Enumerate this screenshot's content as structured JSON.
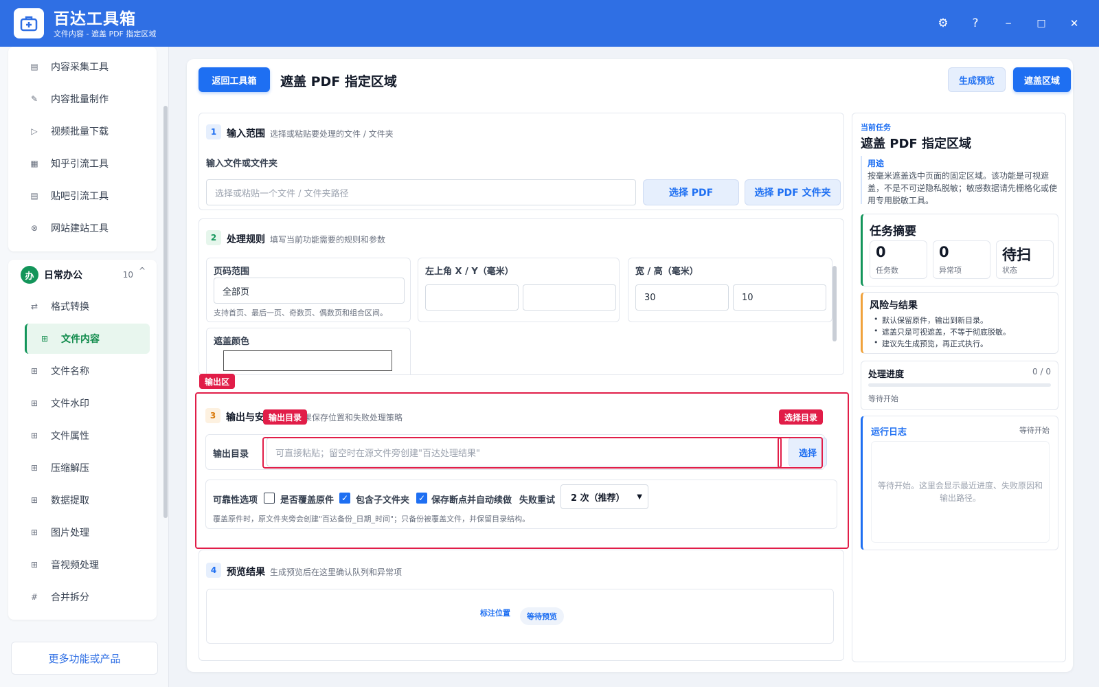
{
  "app": {
    "title": "百达工具箱",
    "subtitle": "文件内容 - 遮盖 PDF 指定区域"
  },
  "window_controls": {
    "settings": "⚙",
    "help": "?",
    "minimize": "−",
    "maximize": "□",
    "close": "✕"
  },
  "sidebar": {
    "top_items": [
      {
        "label": "内容采集工具",
        "icon": "▤"
      },
      {
        "label": "内容批量制作",
        "icon": "✎"
      },
      {
        "label": "视频批量下载",
        "icon": "▷"
      },
      {
        "label": "知乎引流工具",
        "icon": "▦"
      },
      {
        "label": "贴吧引流工具",
        "icon": "▤"
      },
      {
        "label": "网站建站工具",
        "icon": "⊗"
      }
    ],
    "group": {
      "badge": "办",
      "name": "日常办公",
      "count": "10",
      "chevron": "^"
    },
    "group_items": [
      {
        "label": "格式转换",
        "icon": "⇄"
      },
      {
        "label": "文件内容",
        "icon": "⊞"
      },
      {
        "label": "文件名称",
        "icon": "⊞"
      },
      {
        "label": "文件水印",
        "icon": "⊞"
      },
      {
        "label": "文件属性",
        "icon": "⊞"
      },
      {
        "label": "压缩解压",
        "icon": "⊞"
      },
      {
        "label": "数据提取",
        "icon": "⊞"
      },
      {
        "label": "图片处理",
        "icon": "⊞"
      },
      {
        "label": "音视频处理",
        "icon": "⊞"
      },
      {
        "label": "合并拆分",
        "icon": "#"
      }
    ],
    "active_item": "文件内容",
    "more_label": "更多功能或产品"
  },
  "header": {
    "back_label": "返回工具箱",
    "title": "遮盖 PDF 指定区域",
    "preview_label": "生成预览",
    "run_label": "遮盖区域"
  },
  "section1": {
    "num": "1",
    "title": "输入范围",
    "desc": "选择或粘贴要处理的文件 / 文件夹",
    "field_label": "输入文件或文件夹",
    "placeholder": "选择或粘贴一个文件 / 文件夹路径",
    "choose_pdf": "选择 PDF",
    "choose_folder": "选择 PDF 文件夹"
  },
  "section2": {
    "num": "2",
    "title": "处理规则",
    "desc": "填写当前功能需要的规则和参数",
    "page_range_label": "页码范围",
    "page_range_value": "全部页",
    "page_range_hint": "支持首页、最后一页、奇数页、偶数页和组合区间。",
    "xy_label": "左上角 X / Y（毫米）",
    "x_value": "",
    "y_value": "",
    "wh_label": "宽 / 高（毫米）",
    "w_value": "30",
    "h_value": "10",
    "color_label": "遮盖颜色"
  },
  "annotations": {
    "output_area": "输出区",
    "output_dir": "输出目录",
    "choose_dir": "选择目录"
  },
  "section3": {
    "num": "3",
    "title": "输出与安全",
    "desc": "确认结果保存位置和失败处理策略",
    "dir_label": "输出目录",
    "dir_placeholder": "可直接粘贴；留空时在源文件旁创建\"百达处理结果\"",
    "choose_label": "选择",
    "reliability_label": "可靠性选项",
    "overwrite_label": "是否覆盖原件",
    "overwrite_checked": false,
    "subfolder_label": "包含子文件夹",
    "subfolder_checked": true,
    "resume_label": "保存断点并自动续做",
    "resume_checked": true,
    "retry_label": "失败重试",
    "retry_value": "2 次（推荐）",
    "note": "覆盖原件时，原文件夹旁会创建\"百达备份_日期_时间\"；只备份被覆盖文件，并保留目录结构。"
  },
  "section4": {
    "num": "4",
    "title": "预览结果",
    "desc": "生成预览后在这里确认队列和异常项",
    "mark_label": "标注位置",
    "wait_badge": "等待预览"
  },
  "right_panel": {
    "current_label": "当前任务",
    "task_title": "遮盖 PDF 指定区域",
    "usage_label": "用途",
    "usage_text": "按毫米遮盖选中页面的固定区域。该功能是可视遮盖，不是不可逆隐私脱敏；敏感数据请先栅格化或使用专用脱敏工具。",
    "summary_title": "任务摘要",
    "stats": [
      {
        "value": "0",
        "label": "任务数"
      },
      {
        "value": "0",
        "label": "异常项"
      },
      {
        "value": "待扫",
        "label": "状态"
      }
    ],
    "risk_title": "风险与结果",
    "risk_items": [
      "默认保留原件，输出到新目录。",
      "遮盖只是可视遮盖，不等于彻底脱敏。",
      "建议先生成预览，再正式执行。"
    ],
    "progress_title": "处理进度",
    "progress_count": "0 / 0",
    "progress_fraction": 0,
    "progress_status": "等待开始",
    "log_title": "运行日志",
    "log_status": "等待开始",
    "log_text": "等待开始。这里会显示最近进度、失败原因和输出路径。"
  },
  "colors": {
    "primary": "#1e6ff2",
    "titlebar": "#2f6fe4",
    "active_green": "#13955a",
    "annotation_red": "#e11d48",
    "risk_orange": "#f0a23b"
  }
}
